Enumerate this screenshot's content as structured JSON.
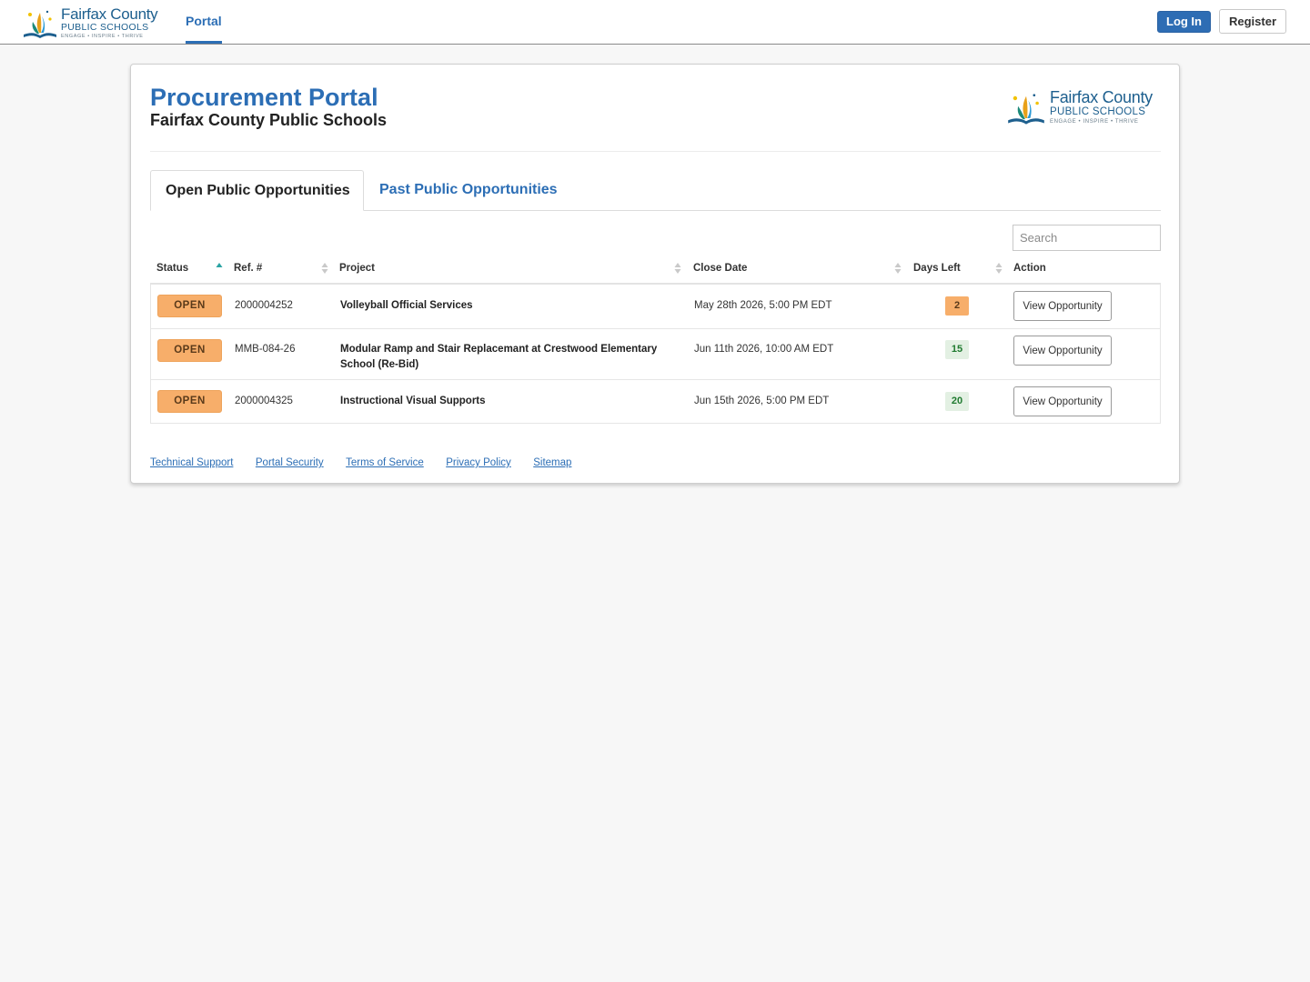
{
  "header": {
    "brand": {
      "name": "Fairfax County",
      "sub": "PUBLIC SCHOOLS",
      "tagline": "ENGAGE • INSPIRE • THRIVE"
    },
    "nav": {
      "portal_label": "Portal"
    },
    "login_label": "Log In",
    "register_label": "Register"
  },
  "page": {
    "title": "Procurement Portal",
    "subtitle": "Fairfax County Public Schools"
  },
  "tabs": [
    {
      "label": "Open Public Opportunities",
      "active": true
    },
    {
      "label": "Past Public Opportunities",
      "active": false
    }
  ],
  "search": {
    "placeholder": "Search",
    "value": ""
  },
  "table": {
    "columns": [
      "Status",
      "Ref. #",
      "Project",
      "Close Date",
      "Days Left",
      "Action"
    ],
    "sorted_column": "Status",
    "sort_direction": "ascending",
    "rows": [
      {
        "status": "OPEN",
        "ref": "2000004252",
        "project": "Volleyball Official Services",
        "close_date": "May 28th 2026, 5:00 PM EDT",
        "days_left": "2",
        "days_level": "urgent",
        "action": "View Opportunity"
      },
      {
        "status": "OPEN",
        "ref": "MMB-084-26",
        "project": "Modular Ramp and Stair Replacemant at Crestwood Elementary School (Re-Bid)",
        "close_date": "Jun 11th 2026, 10:00 AM EDT",
        "days_left": "15",
        "days_level": "ok",
        "action": "View Opportunity"
      },
      {
        "status": "OPEN",
        "ref": "2000004325",
        "project": "Instructional Visual Supports",
        "close_date": "Jun 15th 2026, 5:00 PM EDT",
        "days_left": "20",
        "days_level": "ok",
        "action": "View Opportunity"
      }
    ]
  },
  "footer": {
    "links": [
      "Technical Support",
      "Portal Security",
      "Terms of Service",
      "Privacy Policy",
      "Sitemap"
    ]
  },
  "colors": {
    "brand_blue": "#2c6eb5",
    "status_open": "#f7ae6a",
    "days_ok_bg": "#e3f0e3",
    "days_ok_text": "#1f7a2f"
  },
  "icons": {
    "logo": "fcps-logo-icon",
    "sort_asc": "sort-asc-icon",
    "sort_both": "sort-both-icon"
  }
}
